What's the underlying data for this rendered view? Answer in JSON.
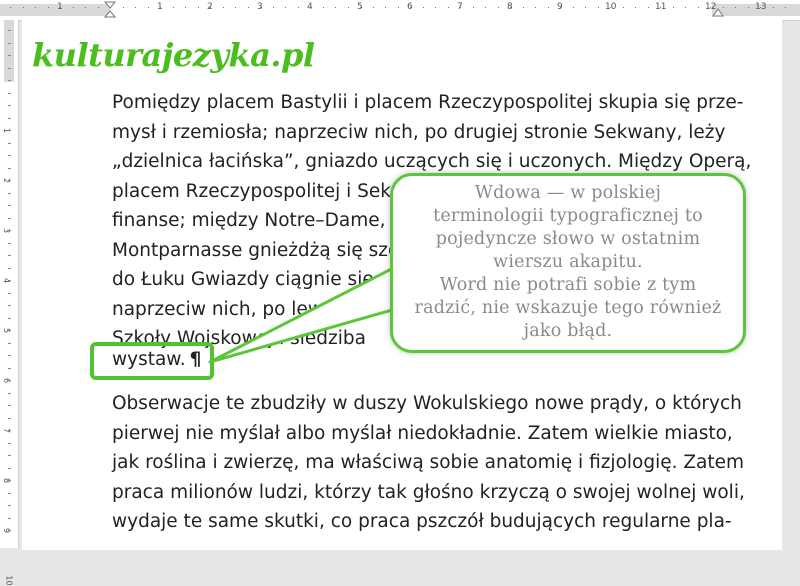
{
  "ruler": {
    "numbers": [
      "1",
      "1",
      "2",
      "3",
      "4",
      "5",
      "6",
      "7",
      "8",
      "9",
      "10",
      "11",
      "12",
      "13"
    ],
    "vertical_numbers": [
      "1",
      "2",
      "3",
      "4",
      "5",
      "6",
      "7",
      "8",
      "9",
      "10"
    ]
  },
  "logo": "kulturajezyka.pl",
  "paragraph1": {
    "lines": [
      "Pomiędzy placem Bastylii i placem Rzeczypospolitej skupia się prze-",
      "mysł i rzemiosła; naprzeciw nich, po drugiej stronie Sekwany, leży",
      "„dzielnica łacińska”, gniazdo uczących się i uczonych. Między Operą,",
      "placem Rzeczypospolitej i Sekw",
      "finanse; między Notre–Dame, In",
      "Montparnasse gnieżdżą się szcz",
      "do Łuku Gwiazdy ciągnie się dzi",
      "naprzeciw nich, po lewej st",
      "Szkoły Wojskowej i      siedziba"
    ]
  },
  "widow": {
    "word": "wystaw.",
    "pilcrow": "¶"
  },
  "callout": {
    "lines": [
      "Wdowa — w  polskiej",
      "terminologii typograficznej to",
      "pojedyncze słowo w ostatnim",
      "wierszu akapitu.",
      "Word nie potrafi sobie z tym",
      "radzić, nie wskazuje tego również",
      "jako błąd."
    ]
  },
  "paragraph2": {
    "lines": [
      "Obserwacje te zbudziły w duszy Wokulskiego nowe prądy, o których",
      "pierwej nie myślał albo myślał niedokładnie. Zatem wielkie miasto,",
      "jak roślina i zwierzę, ma właściwą sobie anatomię i fizjologię. Zatem",
      "praca milionów ludzi, którzy tak głośno krzyczą o swojej wolnej woli,",
      "wydaje te same skutki, co praca pszczół budujących regularne pla-"
    ]
  },
  "colors": {
    "accent_green": "#51c332",
    "logo_green": "#4cbd1f",
    "callout_text": "#8a8a8a"
  }
}
